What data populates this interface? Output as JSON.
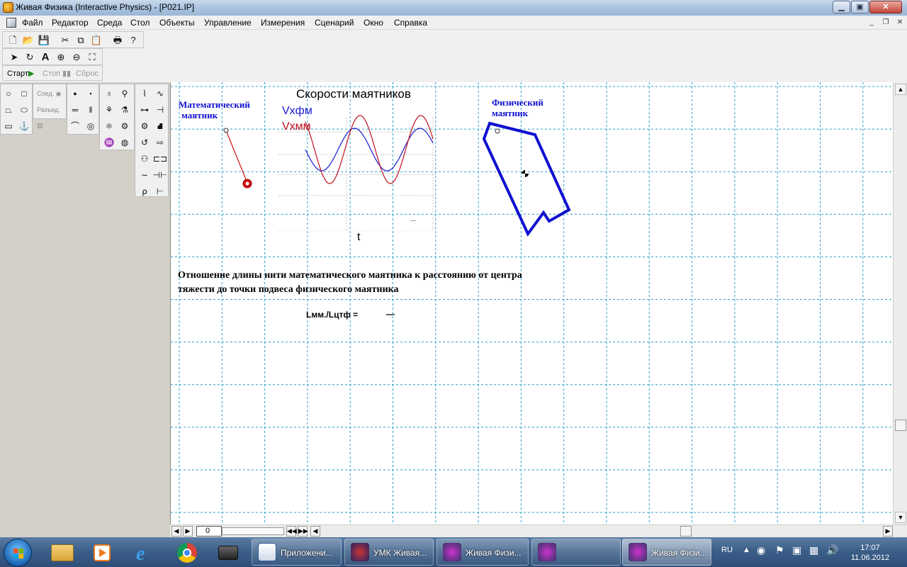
{
  "window": {
    "title": "Живая Физика (Interactive Physics) - [P021.IP]"
  },
  "menu": {
    "items": [
      "Файл",
      "Редактор",
      "Среда",
      "Стол",
      "Объекты",
      "Управление",
      "Измерения",
      "Сценарий",
      "Окно",
      "Справка"
    ]
  },
  "run_controls": {
    "start": "Старт",
    "stop": "Стоп",
    "reset": "Сброс"
  },
  "palette": {
    "join": "Соед.",
    "split": "Разъед."
  },
  "workspace": {
    "math_pendulum_label": [
      "Математический",
      "маятник"
    ],
    "phys_pendulum_label": [
      "Физический",
      "маятник"
    ],
    "chart_title": "Скорости маятников",
    "legend_phys": "Vxфм",
    "legend_math": "Vxмм",
    "x_axis_label": "t",
    "axis_ellipsis": "...",
    "description_line1": "Отношение длины нити математического маятника к расстоянию от центра",
    "description_line2": "тяжести до точки подвеса физического маятника",
    "formula_label": "Lмм./Lцтф =",
    "formula_value": "—"
  },
  "frame": {
    "value": "0"
  },
  "chart_data": {
    "type": "line",
    "title": "Скорости маятников",
    "xlabel": "t",
    "ylabel": "",
    "series": [
      {
        "name": "Vxфм",
        "color": "#1a1ad0",
        "amplitude": 1.0,
        "cycles": 1.95
      },
      {
        "name": "Vxмм",
        "color": "#c01020",
        "amplitude": 1.6,
        "cycles": 2.1
      }
    ]
  },
  "colors": {
    "grid": "#2aa0c8",
    "label_blue": "#1010d0",
    "math_pendulum": "#d01010",
    "phys_pendulum": "#1010d0"
  },
  "taskbar": {
    "tasks": [
      "Приложени...",
      "УМК Живая...",
      "Живая Физи...",
      "Живая Физи..."
    ],
    "lang": "RU",
    "time": "17:07",
    "date": "11.06.2012"
  }
}
